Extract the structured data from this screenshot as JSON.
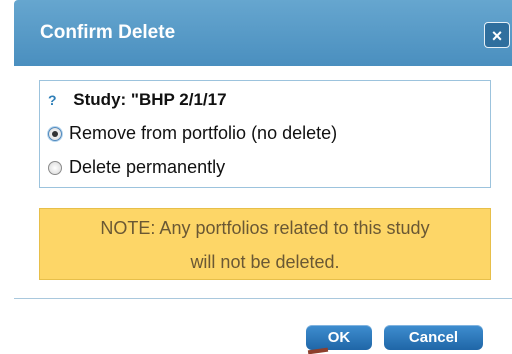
{
  "dialog": {
    "title": "Confirm Delete",
    "close_label": "×",
    "study_label": "Study: \"BHP 2/1/17",
    "help_glyph": "?",
    "options": [
      {
        "label": "Remove from portfolio (no delete)",
        "selected": true
      },
      {
        "label": "Delete permanently",
        "selected": false
      }
    ],
    "note_line1": "NOTE: Any portfolios related to this study",
    "note_line2": "will not be deleted.",
    "ok_label": "OK",
    "cancel_label": "Cancel"
  },
  "colors": {
    "title_bar": "#4a8fbf",
    "note_bg": "#fdd667",
    "button": "#1f66a7"
  },
  "icons": {
    "close": "close-icon",
    "help": "question-mark-icon",
    "radio_selected": "radio-selected-icon",
    "radio_unselected": "radio-unselected-icon"
  }
}
